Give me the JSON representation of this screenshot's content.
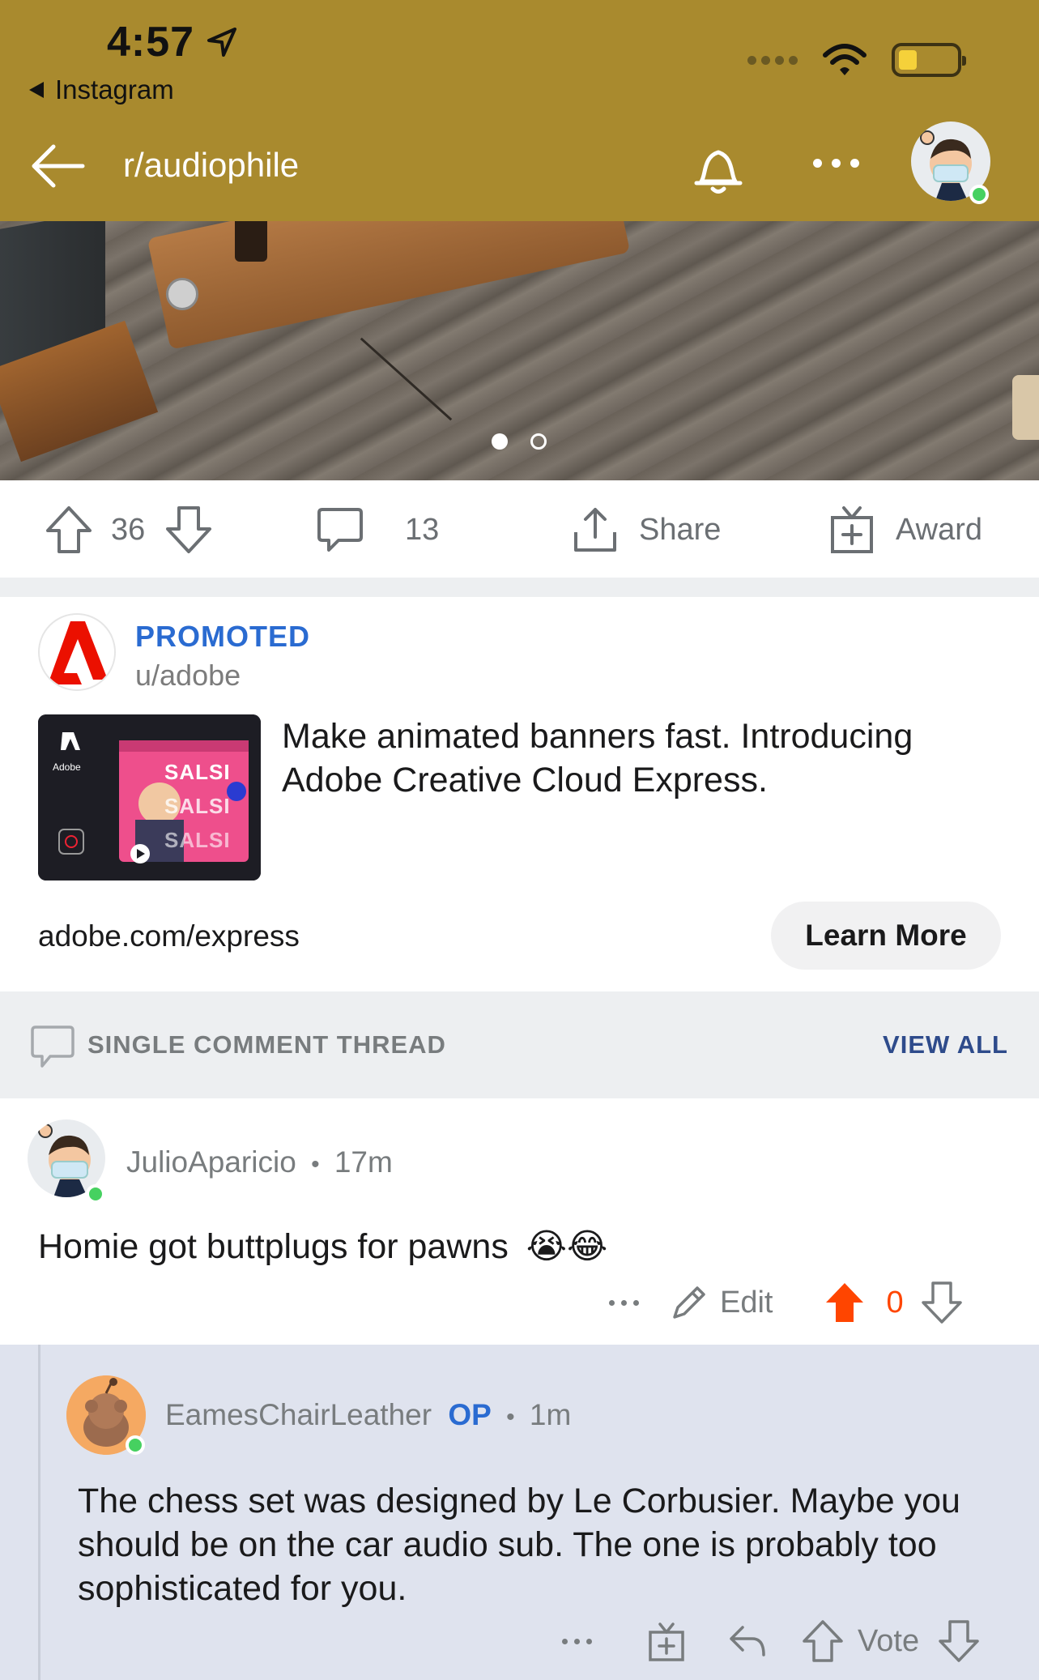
{
  "status_bar": {
    "time": "4:57",
    "back_app": "Instagram"
  },
  "header": {
    "subreddit": "r/audiophile",
    "bg_color": "#a98a2e"
  },
  "post_image": {
    "page_count": 2,
    "active_page": 1
  },
  "action_bar": {
    "votes": "36",
    "comments": "13",
    "share_label": "Share",
    "award_label": "Award"
  },
  "ad": {
    "promoted_label": "PROMOTED",
    "user": "u/adobe",
    "headline": "Make animated banners fast. Introducing Adobe Creative Cloud Express.",
    "url": "adobe.com/express",
    "cta_label": "Learn More",
    "thumb_brand": "Adobe",
    "thumb_word": "SALSI"
  },
  "thread": {
    "label": "SINGLE COMMENT THREAD",
    "view_all": "VIEW ALL"
  },
  "comment1": {
    "author": "JulioAparicio",
    "time": "17m",
    "body": "Homie got buttplugs for pawns",
    "emojis": "😭😂",
    "edit_label": "Edit",
    "score": "0",
    "upvote_color": "#ff4500"
  },
  "reply": {
    "author": "EamesChairLeather",
    "op_label": "OP",
    "time": "1m",
    "body": "The chess set was designed by Le Corbusier. Maybe you should be on the car audio sub. The one is probably too sophisticated for you.",
    "vote_label": "Vote"
  },
  "separator": "•"
}
